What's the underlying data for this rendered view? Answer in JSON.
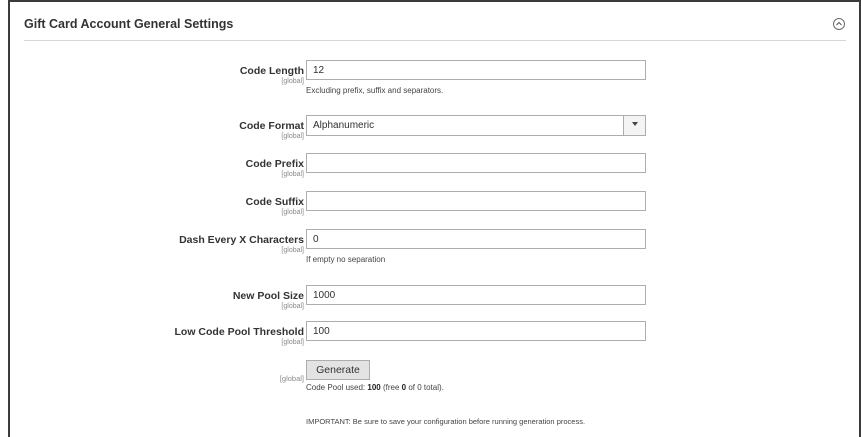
{
  "section": {
    "title": "Gift Card Account General Settings"
  },
  "fields": {
    "code_length": {
      "label": "Code Length",
      "scope": "[global]",
      "value": "12",
      "note": "Excluding prefix, suffix and separators."
    },
    "code_format": {
      "label": "Code Format",
      "scope": "[global]",
      "selected": "Alphanumeric"
    },
    "code_prefix": {
      "label": "Code Prefix",
      "scope": "[global]",
      "value": ""
    },
    "code_suffix": {
      "label": "Code Suffix",
      "scope": "[global]",
      "value": ""
    },
    "dash_every": {
      "label": "Dash Every X Characters",
      "scope": "[global]",
      "value": "0",
      "note": "If empty no separation"
    },
    "new_pool_size": {
      "label": "New Pool Size",
      "scope": "[global]",
      "value": "1000"
    },
    "low_threshold": {
      "label": "Low Code Pool Threshold",
      "scope": "[global]",
      "value": "100"
    }
  },
  "generate": {
    "scope": "[global]",
    "button_label": "Generate",
    "pool_used_prefix": "Code Pool used: ",
    "pool_used_value": "100",
    "pool_free_prefix": " (free ",
    "pool_free_value": "0",
    "pool_suffix": " of 0 total).",
    "important_note": "IMPORTANT: Be sure to save your configuration before running generation process."
  },
  "icons": {
    "collapse": "chevron-up-circle-icon",
    "select_arrow": "chevron-down-icon"
  }
}
